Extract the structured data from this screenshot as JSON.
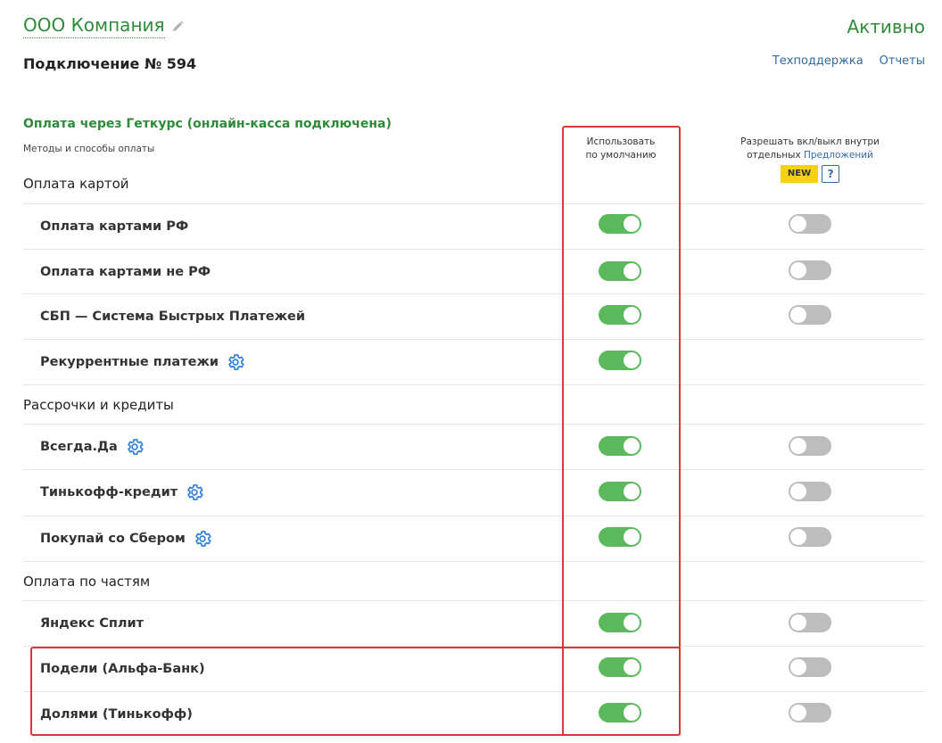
{
  "header": {
    "company_name": "ООО Компания",
    "status": "Активно",
    "connection_title": "Подключение № 594",
    "links": {
      "support": "Техподдержка",
      "reports": "Отчеты"
    }
  },
  "section": {
    "title": "Оплата через Геткурс (онлайн-касса подключена)",
    "subtitle": "Методы и способы оплаты"
  },
  "columns": {
    "default_line1": "Использовать",
    "default_line2": "по умолчанию",
    "offers_line1": "Разрешать вкл/выкл внутри",
    "offers_prefix": "отдельных ",
    "offers_link": "Предложений",
    "new_badge": "NEW",
    "help": "?"
  },
  "groups": {
    "cards": "Оплата картой",
    "credit": "Рассрочки и кредиты",
    "parts": "Оплата по частям"
  },
  "rows": [
    {
      "label": "Оплата картами РФ",
      "default_on": true,
      "offers_on": false
    },
    {
      "label": "Оплата картами не РФ",
      "default_on": true,
      "offers_on": false
    },
    {
      "label": "СБП — Система Быстрых Платежей",
      "default_on": true,
      "offers_on": false
    },
    {
      "label": "Рекуррентные платежи",
      "default_on": true,
      "offers_on": null
    },
    {
      "label": "Всегда.Да",
      "default_on": true,
      "offers_on": false
    },
    {
      "label": "Тинькофф-кредит",
      "default_on": true,
      "offers_on": false
    },
    {
      "label": "Покупай со Сбером",
      "default_on": true,
      "offers_on": false
    },
    {
      "label": "Яндекс Сплит",
      "default_on": true,
      "offers_on": false
    },
    {
      "label": "Подели (Альфа-Банк)",
      "default_on": true,
      "offers_on": false
    },
    {
      "label": "Долями (Тинькофф)",
      "default_on": true,
      "offers_on": false
    }
  ],
  "colors": {
    "accent_green": "#2e8b3a",
    "toggle_on": "#5cb85c",
    "toggle_off": "#bdbdbd",
    "link_blue": "#2f6aa6",
    "highlight_red": "#d9383a",
    "badge_yellow": "#f6d10f"
  }
}
